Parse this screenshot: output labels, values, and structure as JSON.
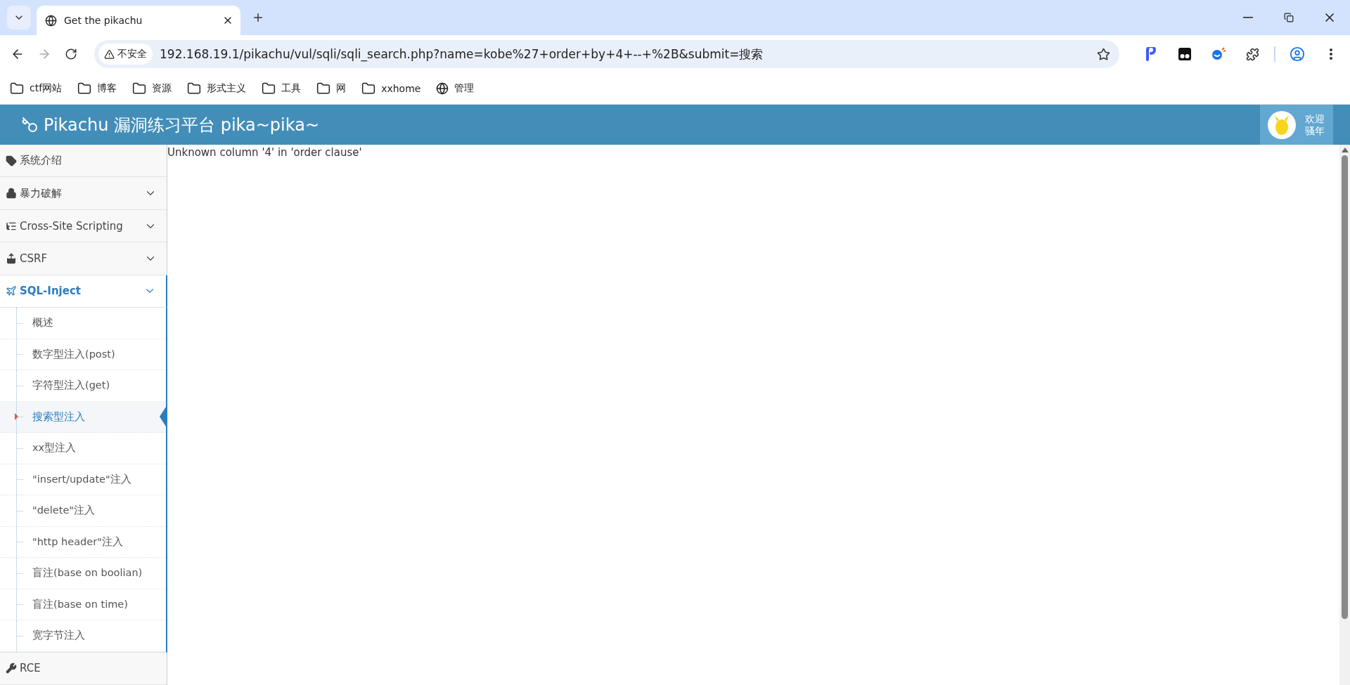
{
  "browser": {
    "tabs": [
      {
        "title": "Get the pikachu",
        "selected": true
      }
    ],
    "security_label": "不安全",
    "url": "192.168.19.1/pikachu/vul/sqli/sqli_search.php?name=kobe%27+order+by+4+--+%2B&submit=搜索",
    "bookmarks": [
      {
        "kind": "folder",
        "label": "ctf网站"
      },
      {
        "kind": "folder",
        "label": "博客"
      },
      {
        "kind": "folder",
        "label": "资源"
      },
      {
        "kind": "folder",
        "label": "形式主义"
      },
      {
        "kind": "folder",
        "label": "工具"
      },
      {
        "kind": "folder",
        "label": "网"
      },
      {
        "kind": "folder",
        "label": "xxhome"
      },
      {
        "kind": "site",
        "label": "管理"
      }
    ]
  },
  "header": {
    "title": "Pikachu 漏洞练习平台 pika~pika~",
    "greeting": [
      "欢迎",
      "骚年"
    ]
  },
  "sidebar": {
    "items": [
      {
        "label": "系统介绍",
        "expandable": false,
        "expanded": false,
        "selected": false
      },
      {
        "label": "暴力破解",
        "expandable": true,
        "expanded": false,
        "selected": false
      },
      {
        "label": "Cross-Site Scripting",
        "expandable": true,
        "expanded": false,
        "selected": false
      },
      {
        "label": "CSRF",
        "expandable": true,
        "expanded": false,
        "selected": false
      },
      {
        "label": "SQL-Inject",
        "expandable": true,
        "expanded": true,
        "selected": true,
        "children": [
          {
            "label": "概述",
            "selected": false
          },
          {
            "label": "数字型注入(post)",
            "selected": false
          },
          {
            "label": "字符型注入(get)",
            "selected": false
          },
          {
            "label": "搜索型注入",
            "selected": true
          },
          {
            "label": "xx型注入",
            "selected": false
          },
          {
            "label": "\"insert/update\"注入",
            "selected": false
          },
          {
            "label": "\"delete\"注入",
            "selected": false
          },
          {
            "label": "\"http header\"注入",
            "selected": false
          },
          {
            "label": "盲注(base on boolian)",
            "selected": false
          },
          {
            "label": "盲注(base on time)",
            "selected": false
          },
          {
            "label": "宽字节注入",
            "selected": false
          }
        ]
      },
      {
        "label": "RCE",
        "expandable": false,
        "expanded": false,
        "selected": false
      }
    ]
  },
  "content": {
    "message": "Unknown column '4' in 'order clause'"
  }
}
